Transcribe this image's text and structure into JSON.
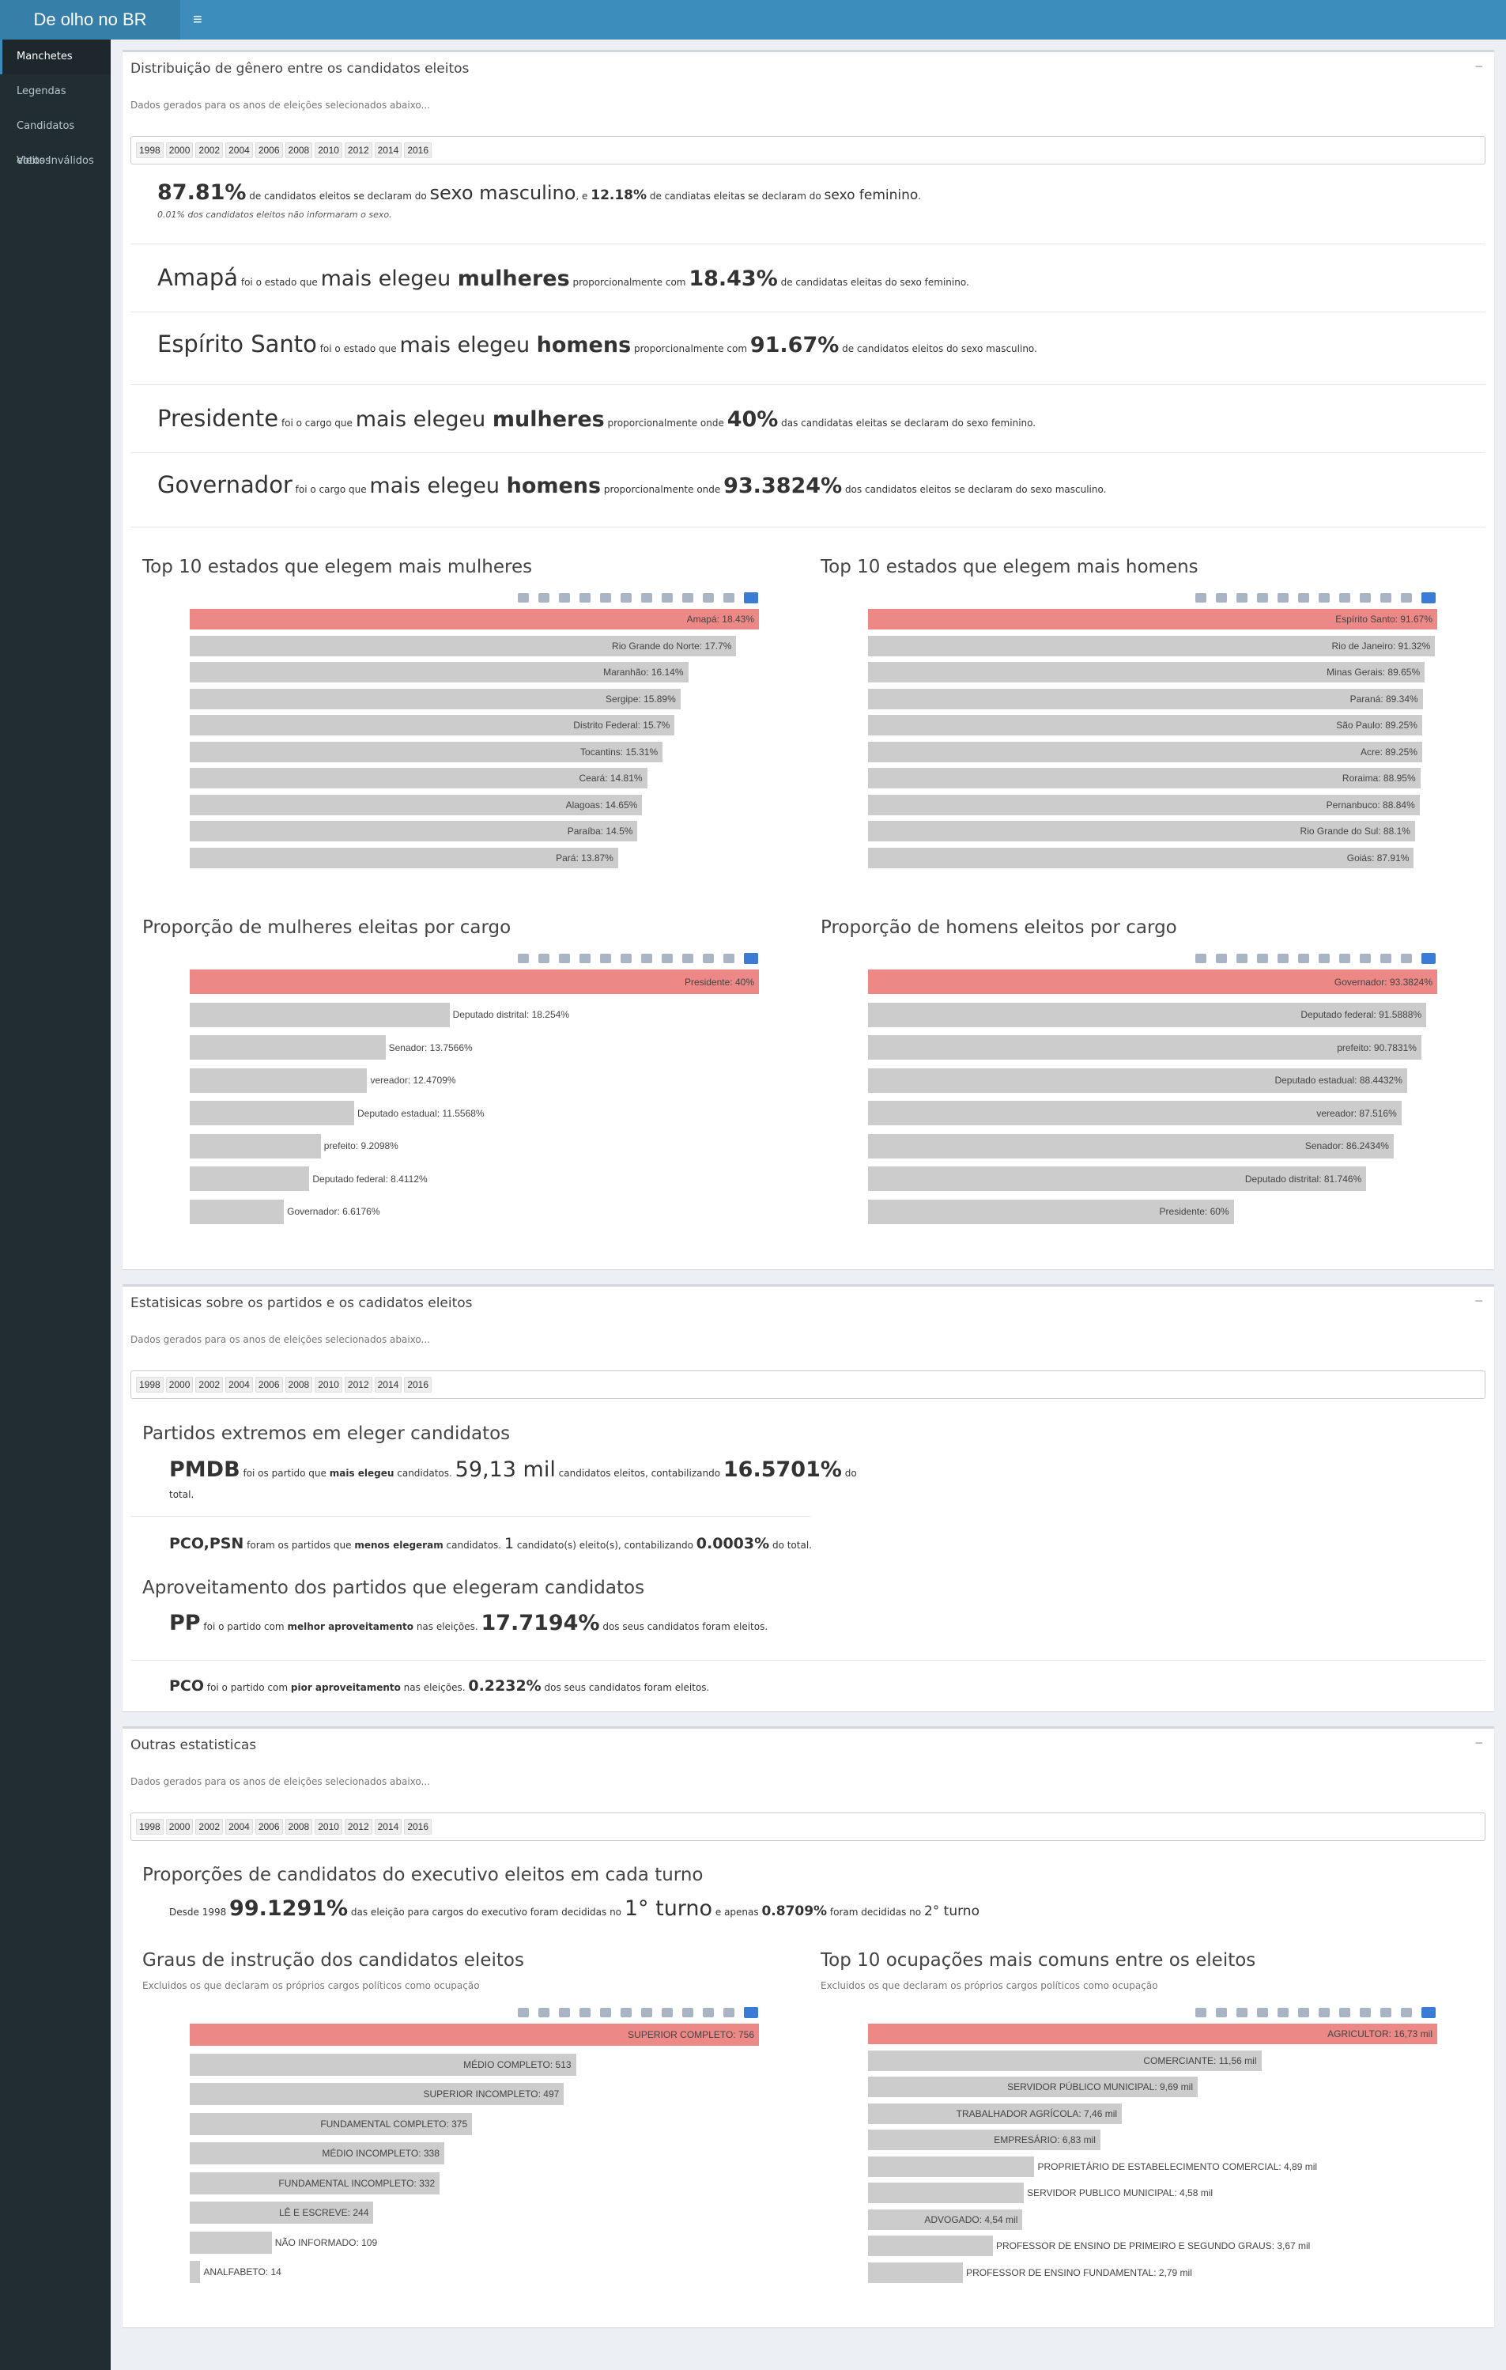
{
  "header": {
    "brand": "De olho no BR",
    "menu_icon": "≡"
  },
  "sidebar": {
    "items": [
      {
        "label": "Manchetes",
        "active": true
      },
      {
        "label": "Legendas"
      },
      {
        "label": "Candidatos eleitos"
      },
      {
        "label": "Votos Inválidos"
      }
    ]
  },
  "years": [
    "1998",
    "2000",
    "2002",
    "2004",
    "2006",
    "2008",
    "2010",
    "2012",
    "2014",
    "2016"
  ],
  "colors": {
    "highlight": "#ec8886",
    "bar": "#cccccc",
    "brand": "#3c8dbc"
  },
  "gender": {
    "title": "Distribuição de gênero entre os candidatos eleitos",
    "note": "Dados gerados para os anos de eleições selecionados abaixo...",
    "collapse": "−",
    "headline": {
      "male_pct": "87.81%",
      "t1": " de candidatos eleitos se declaram do ",
      "male_label": "sexo masculino",
      "t2": ", e ",
      "female_pct": "12.18%",
      "t3": " de candiatas eleitas se declaram do ",
      "female_label": "sexo feminino",
      "t4": ".",
      "unknown": "0.01% dos candidatos eleitos não informaram o sexo."
    },
    "state_women": {
      "name": "Amapá",
      "t1": " foi o estado que ",
      "big1": "mais elegeu ",
      "bold": "mulheres",
      "t2": " proporcionalmente com ",
      "pct": "18.43%",
      "t3": " de candidatas eleitas do sexo feminino."
    },
    "state_men": {
      "name": "Espírito Santo",
      "t1": " foi o estado que ",
      "big1": "mais elegeu ",
      "bold": "homens",
      "t2": " proporcionalmente com ",
      "pct": "91.67%",
      "t3": " de candidatos eleitos do sexo masculino."
    },
    "role_women": {
      "name": "Presidente",
      "t1": " foi o cargo que ",
      "big1": "mais elegeu ",
      "bold": "mulheres",
      "t2": " proporcionalmente onde ",
      "pct": "40%",
      "t3": " das candidatas eleitas se declaram do sexo feminino."
    },
    "role_men": {
      "name": "Governador",
      "t1": " foi o cargo que ",
      "big1": "mais elegeu ",
      "bold": "homens",
      "t2": " proporcionalmente onde ",
      "pct": "93.3824%",
      "t3": " dos candidatos eleitos se declaram do sexo masculino."
    }
  },
  "parties": {
    "title": "Estatisicas sobre os partidos e os cadidatos eleitos",
    "note": "Dados gerados para os anos de eleições selecionados abaixo...",
    "collapse": "−",
    "extremes_title": "Partidos extremos em eleger candidatos",
    "most": {
      "party": "PMDB",
      "t1": " foi os partido que ",
      "bold": "mais elegeu",
      "t2": " candidatos. ",
      "count": "59,13 mil",
      "t3": " candidatos eleitos, contabilizando ",
      "pct": "16.5701%",
      "t4": " do",
      "t5": "total."
    },
    "least": {
      "party": "PCO,PSN",
      "t1": " foram os partidos que ",
      "bold": "menos elegeram",
      "t2": " candidatos. ",
      "count": "1",
      "t3": " candidato(s) eleito(s), contabilizando ",
      "pct": "0.0003%",
      "t4": " do total."
    },
    "efficiency_title": "Aproveitamento dos partidos que elegeram candidatos",
    "best": {
      "party": "PP",
      "t1": " foi o partido com ",
      "bold": "melhor aproveitamento",
      "t2": " nas eleições. ",
      "pct": "17.7194%",
      "t3": " dos seus candidatos foram eleitos."
    },
    "worst": {
      "party": "PCO",
      "t1": " foi o partido com ",
      "bold": "pior aproveitamento",
      "t2": " nas eleições. ",
      "pct": "0.2232%",
      "t3": " dos seus candidatos foram eleitos."
    }
  },
  "other": {
    "title": "Outras estatisticas",
    "note": "Dados gerados para os anos de eleições selecionados abaixo...",
    "collapse": "−",
    "turns_title": "Proporções de candidatos do executivo eleitos em cada turno",
    "turns": {
      "t1": "Desde 1998 ",
      "pct1": "99.1291%",
      "t2": " das eleição para cargos do executivo foram decididas no ",
      "turn1": "1° turno",
      "t3": " e apenas ",
      "pct2": "0.8709%",
      "t4": " foram decididas no ",
      "turn2": "2° turno"
    },
    "edu_sub": "Excluidos os que declaram os próprios cargos políticos como ocupação",
    "occ_sub": "Excluidos os que declaram os próprios cargos políticos como ocupação"
  },
  "chart_data": [
    {
      "type": "bar",
      "title": "Top 10 estados que elegem mais mulheres",
      "orientation": "horizontal",
      "categories": [
        "Amapá",
        "Rio Grande do Norte",
        "Maranhão",
        "Sergipe",
        "Distrito Federal",
        "Tocantins",
        "Ceará",
        "Alagoas",
        "Paraíba",
        "Pará"
      ],
      "values": [
        18.43,
        17.7,
        16.14,
        15.89,
        15.7,
        15.31,
        14.81,
        14.65,
        14.5,
        13.87
      ],
      "labels": [
        "Amapá: 18.43%",
        "Rio Grande do Norte: 17.7%",
        "Maranhão: 16.14%",
        "Sergipe: 15.89%",
        "Distrito Federal: 15.7%",
        "Tocantins: 15.31%",
        "Ceará: 14.81%",
        "Alagoas: 14.65%",
        "Paraíba: 14.5%",
        "Pará: 13.87%"
      ]
    },
    {
      "type": "bar",
      "title": "Top 10 estados que elegem mais homens",
      "orientation": "horizontal",
      "categories": [
        "Espírito Santo",
        "Rio de Janeiro",
        "Minas Gerais",
        "Paraná",
        "São Paulo",
        "Acre",
        "Roraima",
        "Pernanbuco",
        "Rio Grande do Sul",
        "Goiás"
      ],
      "values": [
        91.67,
        91.32,
        89.65,
        89.34,
        89.25,
        89.25,
        88.95,
        88.84,
        88.1,
        87.91
      ],
      "labels": [
        "Espírito Santo: 91.67%",
        "Rio de Janeiro: 91.32%",
        "Minas Gerais: 89.65%",
        "Paraná: 89.34%",
        "São Paulo: 89.25%",
        "Acre: 89.25%",
        "Roraima: 88.95%",
        "Pernanbuco: 88.84%",
        "Rio Grande do Sul: 88.1%",
        "Goiás: 87.91%"
      ]
    },
    {
      "type": "bar",
      "title": "Proporção de mulheres eleitas por cargo",
      "orientation": "horizontal",
      "categories": [
        "Presidente",
        "Deputado distrital",
        "Senador",
        "vereador",
        "Deputado estadual",
        "prefeito",
        "Deputado federal",
        "Governador"
      ],
      "values": [
        40,
        18.254,
        13.7566,
        12.4709,
        11.5568,
        9.2098,
        8.4112,
        6.6176
      ],
      "labels": [
        "Presidente: 40%",
        "Deputado distrital: 18.254%",
        "Senador: 13.7566%",
        "vereador: 12.4709%",
        "Deputado estadual: 11.5568%",
        "prefeito: 9.2098%",
        "Deputado federal: 8.4112%",
        "Governador: 6.6176%"
      ]
    },
    {
      "type": "bar",
      "title": "Proporção de homens eleitos por cargo",
      "orientation": "horizontal",
      "categories": [
        "Governador",
        "Deputado federal",
        "prefeito",
        "Deputado estadual",
        "vereador",
        "Senador",
        "Deputado distrital",
        "Presidente"
      ],
      "values": [
        93.3824,
        91.5888,
        90.7831,
        88.4432,
        87.516,
        86.2434,
        81.746,
        60
      ],
      "labels": [
        "Governador: 93.3824%",
        "Deputado federal: 91.5888%",
        "prefeito: 90.7831%",
        "Deputado estadual: 88.4432%",
        "vereador: 87.516%",
        "Senador: 86.2434%",
        "Deputado distrital: 81.746%",
        "Presidente: 60%"
      ]
    },
    {
      "type": "bar",
      "title": "Graus de instrução dos candidatos eleitos",
      "orientation": "horizontal",
      "categories": [
        "SUPERIOR COMPLETO",
        "MÉDIO COMPLETO",
        "SUPERIOR INCOMPLETO",
        "FUNDAMENTAL COMPLETO",
        "MÉDIO INCOMPLETO",
        "FUNDAMENTAL INCOMPLETO",
        "LÊ E ESCREVE",
        "NÃO INFORMADO",
        "ANALFABETO"
      ],
      "values": [
        756,
        513,
        497,
        375,
        338,
        332,
        244,
        109,
        14
      ],
      "labels": [
        "SUPERIOR COMPLETO: 756",
        "MÉDIO COMPLETO: 513",
        "SUPERIOR INCOMPLETO: 497",
        "FUNDAMENTAL COMPLETO: 375",
        "MÉDIO INCOMPLETO: 338",
        "FUNDAMENTAL INCOMPLETO: 332",
        "LÊ E ESCREVE: 244",
        "NÃO INFORMADO: 109",
        "ANALFABETO: 14"
      ]
    },
    {
      "type": "bar",
      "title": "Top 10 ocupações mais comuns entre os eleitos",
      "orientation": "horizontal",
      "categories": [
        "AGRICULTOR",
        "COMERCIANTE",
        "SERVIDOR PÚBLICO MUNICIPAL",
        "TRABALHADOR AGRÍCOLA",
        "EMPRESÁRIO",
        "PROPRIETÁRIO DE ESTABELECIMENTO COMERCIAL",
        "SERVIDOR PUBLICO MUNICIPAL",
        "ADVOGADO",
        "PROFESSOR DE ENSINO DE PRIMEIRO E SEGUNDO GRAUS",
        "PROFESSOR DE ENSINO FUNDAMENTAL"
      ],
      "values": [
        16.73,
        11.56,
        9.69,
        7.46,
        6.83,
        4.89,
        4.58,
        4.54,
        3.67,
        2.79
      ],
      "labels": [
        "AGRICULTOR: 16,73 mil",
        "COMERCIANTE: 11,56 mil",
        "SERVIDOR PÚBLICO MUNICIPAL: 9,69 mil",
        "TRABALHADOR AGRÍCOLA: 7,46 mil",
        "EMPRESÁRIO: 6,83 mil",
        "PROPRIETÁRIO DE ESTABELECIMENTO COMERCIAL: 4,89 mil",
        "SERVIDOR PUBLICO MUNICIPAL: 4,58 mil",
        "ADVOGADO: 4,54 mil",
        "PROFESSOR DE ENSINO DE PRIMEIRO E SEGUNDO GRAUS: 3,67 mil",
        "PROFESSOR DE ENSINO FUNDAMENTAL: 2,79 mil"
      ]
    }
  ]
}
